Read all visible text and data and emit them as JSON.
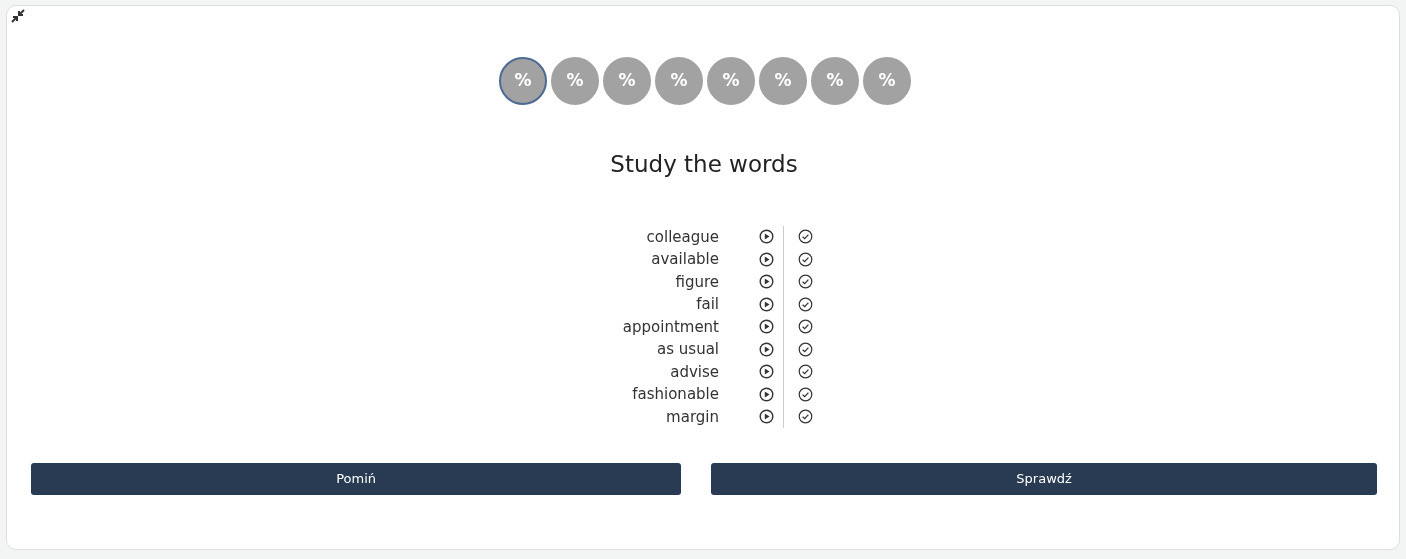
{
  "steps": [
    {
      "label": "%",
      "selected": true
    },
    {
      "label": "%",
      "selected": false
    },
    {
      "label": "%",
      "selected": false
    },
    {
      "label": "%",
      "selected": false
    },
    {
      "label": "%",
      "selected": false
    },
    {
      "label": "%",
      "selected": false
    },
    {
      "label": "%",
      "selected": false
    },
    {
      "label": "%",
      "selected": false
    }
  ],
  "title": "Study the words",
  "words": [
    "colleague",
    "available",
    "figure",
    "fail",
    "appointment",
    "as usual",
    "advise",
    "fashionable",
    "margin"
  ],
  "buttons": [
    "Pomiń",
    "Sprawdź"
  ]
}
